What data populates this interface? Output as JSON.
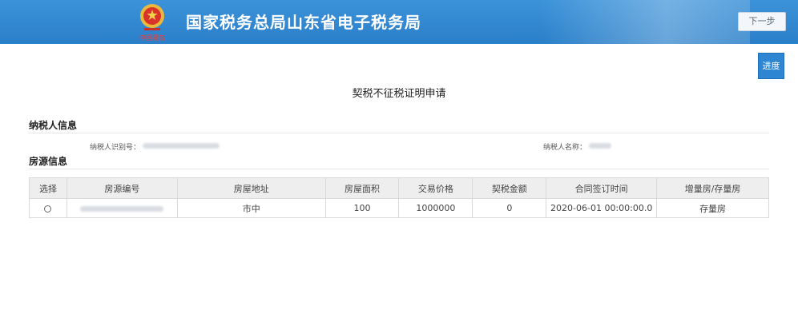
{
  "header": {
    "title": "国家税务总局山东省电子税务局",
    "emblem_caption": "中国税务",
    "next_label": "下一步",
    "bg_color": "#2a7fc9"
  },
  "progress_label": "进度",
  "page_title": "契税不征税证明申请",
  "taxpayer": {
    "section_title": "纳税人信息",
    "id_label": "纳税人识别号：",
    "name_label": "纳税人名称："
  },
  "house": {
    "section_title": "房源信息",
    "columns": [
      "选择",
      "房源编号",
      "房屋地址",
      "房屋面积",
      "交易价格",
      "契税金额",
      "合同签订时间",
      "增量房/存量房"
    ],
    "rows": [
      {
        "address": "市中",
        "area": "100",
        "price": "1000000",
        "tax": "0",
        "contract_time": "2020-06-01 00:00:00.0",
        "house_type": "存量房"
      }
    ]
  }
}
